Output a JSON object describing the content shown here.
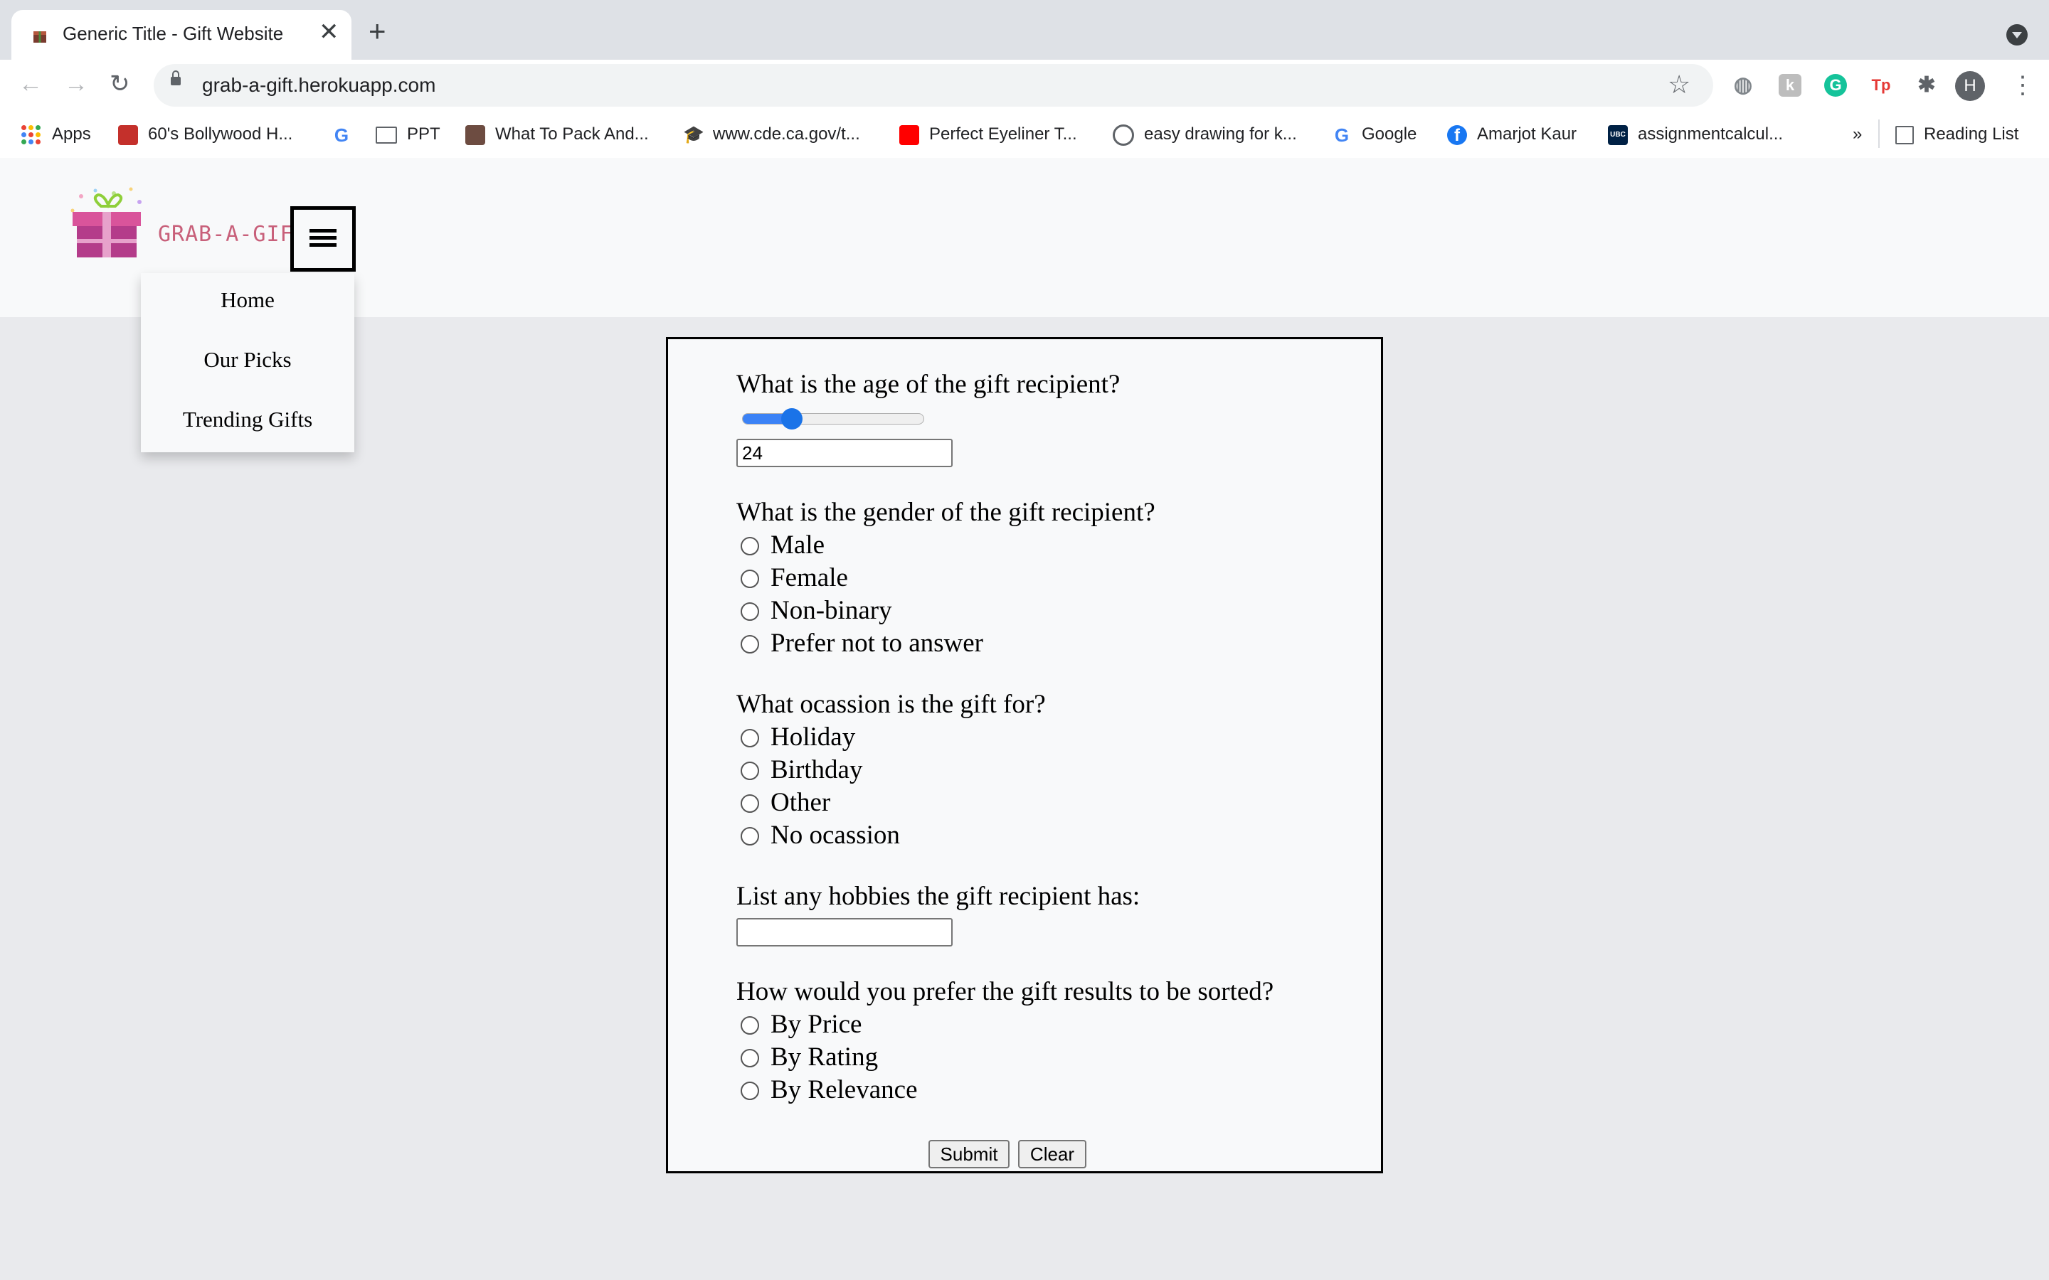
{
  "browser": {
    "tab_title": "Generic Title - Gift Website",
    "url": "grab-a-gift.herokuapp.com",
    "extension_avatar_letter": "H",
    "bookmarks": [
      {
        "label": "Apps"
      },
      {
        "label": "60's Bollywood H..."
      },
      {
        "label": ""
      },
      {
        "label": "PPT"
      },
      {
        "label": "What To Pack And..."
      },
      {
        "label": "www.cde.ca.gov/t..."
      },
      {
        "label": "Perfect Eyeliner T..."
      },
      {
        "label": "easy drawing for k..."
      },
      {
        "label": "Google"
      },
      {
        "label": "Amarjot Kaur"
      },
      {
        "label": "assignmentcalcul..."
      }
    ],
    "bookmarks_overflow": "»",
    "reading_list": "Reading List"
  },
  "site": {
    "logo_text": "GRAB-A-GIFT",
    "menu_items": [
      {
        "label": "Home"
      },
      {
        "label": "Our Picks"
      },
      {
        "label": "Trending Gifts"
      }
    ]
  },
  "form": {
    "age_question": "What is the age of the gift recipient?",
    "age_value": "24",
    "age_slider_fraction": 0.24,
    "gender_question": "What is the gender of the gift recipient?",
    "gender_options": [
      "Male",
      "Female",
      "Non-binary",
      "Prefer not to answer"
    ],
    "occasion_question": "What ocassion is the gift for?",
    "occasion_options": [
      "Holiday",
      "Birthday",
      "Other",
      "No ocassion"
    ],
    "hobbies_question": "List any hobbies the gift recipient has:",
    "hobbies_value": "",
    "sort_question": "How would you prefer the gift results to be sorted?",
    "sort_options": [
      "By Price",
      "By Rating",
      "By Relevance"
    ],
    "submit_label": "Submit",
    "clear_label": "Clear"
  },
  "colors": {
    "accent": "#1a73e8",
    "logo_pink": "#c8607a",
    "page_bg": "#e9eaed",
    "panel_bg": "#f8f9fa"
  }
}
